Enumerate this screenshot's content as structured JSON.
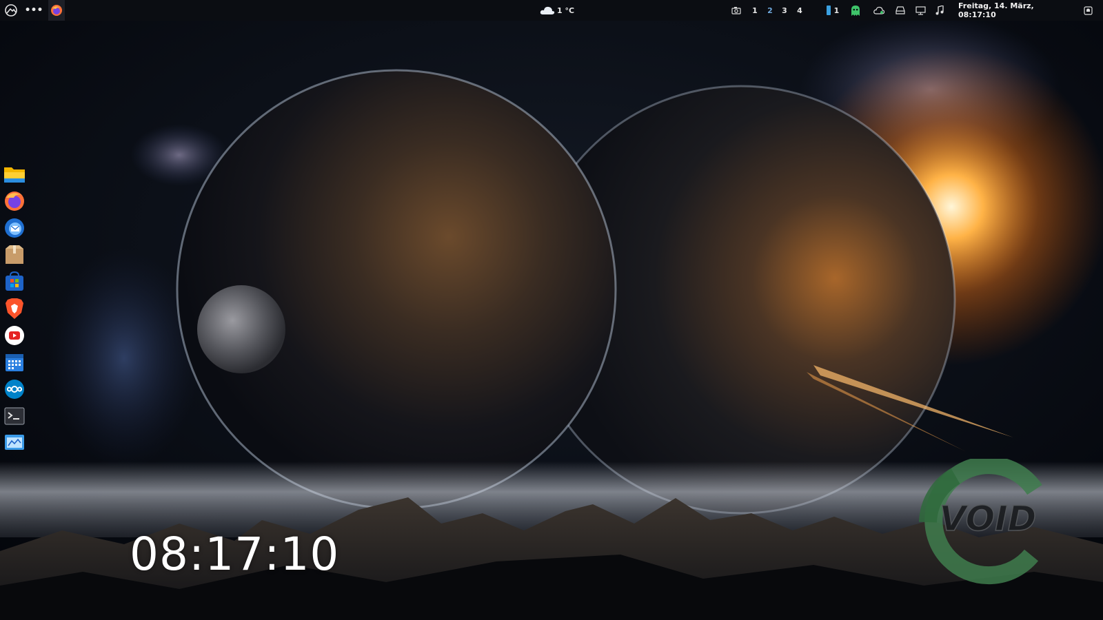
{
  "topbar": {
    "weather": {
      "icon": "cloud-icon",
      "temperature": "1 °C"
    },
    "workspaces": [
      "1",
      "2",
      "3",
      "4"
    ],
    "active_workspace": "2",
    "indicator_count": "1",
    "datetime": "Freitag, 14. März, 08:17:10",
    "left_icons": [
      "void-menu-icon",
      "more-dots-icon",
      "firefox-running-icon"
    ],
    "right_icons": [
      "screenshot-icon",
      "phone-indicator-icon",
      "ghost-icon",
      "cloud-sync-icon",
      "drive-icon",
      "display-icon",
      "music-icon",
      "notifications-icon"
    ]
  },
  "dock": {
    "items": [
      {
        "name": "files",
        "icon": "folder-icon"
      },
      {
        "name": "firefox",
        "icon": "firefox-icon"
      },
      {
        "name": "thunderbird",
        "icon": "thunderbird-icon"
      },
      {
        "name": "archive-manager",
        "icon": "package-icon"
      },
      {
        "name": "software-store",
        "icon": "store-icon"
      },
      {
        "name": "brave",
        "icon": "brave-icon"
      },
      {
        "name": "youtube",
        "icon": "youtube-icon"
      },
      {
        "name": "calendar",
        "icon": "calendar-icon"
      },
      {
        "name": "nextcloud",
        "icon": "nextcloud-icon"
      },
      {
        "name": "terminal",
        "icon": "terminal-icon"
      },
      {
        "name": "system-monitor",
        "icon": "monitor-icon"
      }
    ]
  },
  "desktop": {
    "clock": "08:17:10",
    "logo_text": "VOID",
    "colors": {
      "logo_green": "#3f7d4e",
      "active_workspace": "#6fa8dc",
      "topbar": "#0b0d12"
    }
  }
}
